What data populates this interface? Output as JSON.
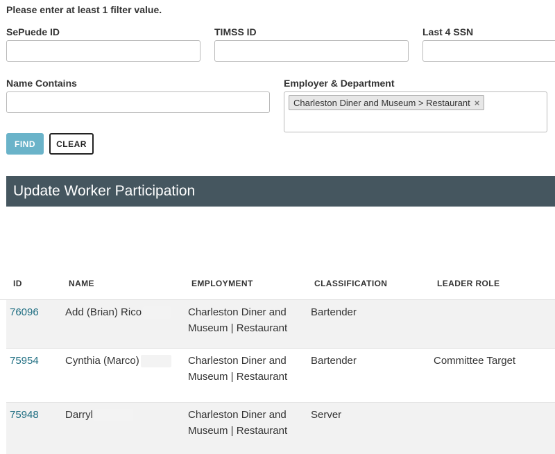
{
  "filters": {
    "notice": "Please enter at least 1 filter value.",
    "sepuede_label": "SePuede ID",
    "timss_label": "TIMSS ID",
    "ssn_label": "Last 4 SSN",
    "name_label": "Name Contains",
    "employer_label": "Employer & Department",
    "sepuede_value": "",
    "timss_value": "",
    "ssn_value": "",
    "name_value": "",
    "employer_selected": "Charleston Diner and Museum > Restaurant",
    "chip_remove_glyph": "×"
  },
  "buttons": {
    "find_label": "FIND",
    "clear_label": "CLEAR"
  },
  "section": {
    "title": "Update Worker Participation"
  },
  "table": {
    "headers": {
      "id": "ID",
      "name": "NAME",
      "employment": "EMPLOYMENT",
      "classification": "CLASSIFICATION",
      "leader_role": "LEADER ROLE"
    },
    "rows": [
      {
        "id": "76096",
        "name": "Add (Brian) Rico",
        "employment_line1": "Charleston Diner and",
        "employment_line2": "Museum | Restaurant",
        "classification": "Bartender",
        "leader_role": ""
      },
      {
        "id": "75954",
        "name": "Cynthia (Marco)",
        "employment_line1": "Charleston Diner and",
        "employment_line2": "Museum | Restaurant",
        "classification": "Bartender",
        "leader_role": "Committee Target"
      },
      {
        "id": "75948",
        "name": "Darryl",
        "employment_line1": "Charleston Diner and",
        "employment_line2": "Museum | Restaurant",
        "classification": "Server",
        "leader_role": ""
      }
    ]
  }
}
